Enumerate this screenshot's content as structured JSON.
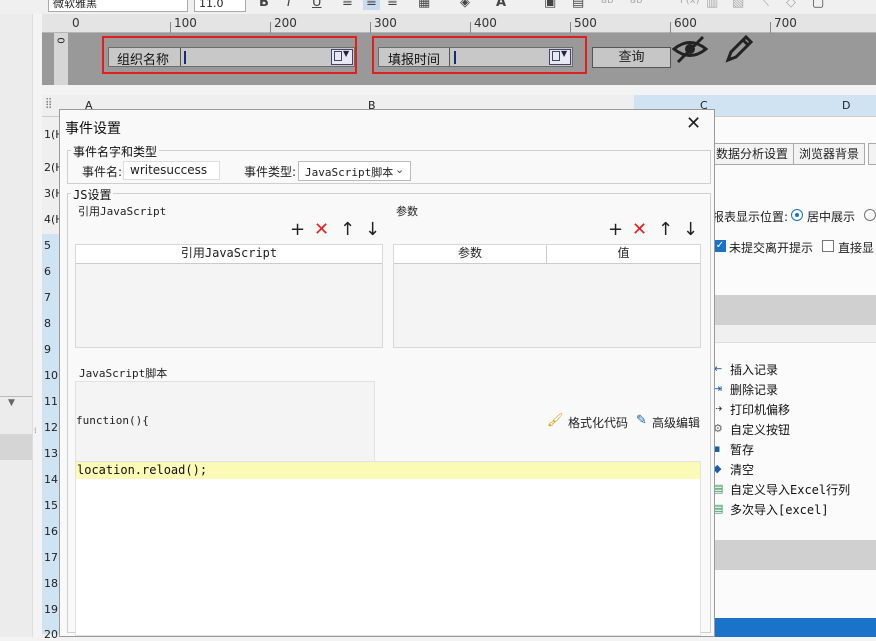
{
  "toolbar": {
    "font_name": "微软雅黑",
    "font_size": "11.0"
  },
  "ruler": {
    "marks": [
      "0",
      "100",
      "200",
      "300",
      "400",
      "500",
      "600",
      "700"
    ],
    "vmark": "0"
  },
  "form": {
    "field1_label": "组织名称",
    "field2_label": "填报时间",
    "query_label": "查询"
  },
  "sheet": {
    "col_a": "A",
    "col_b": "B",
    "col_c": "C",
    "col_d": "D",
    "rows": [
      "1(H",
      "2(H",
      "3(H",
      "4(H",
      "5",
      "6",
      "7",
      "8",
      "9",
      "10",
      "11",
      "12",
      "13",
      "14",
      "15",
      "16",
      "17",
      "18",
      "19",
      "20"
    ]
  },
  "right_panel": {
    "tab1": "数据分析设置",
    "tab2": "浏览器背景",
    "position_label": "报表显示位置:",
    "position_option": "居中展示",
    "leave_prompt": "未提交离开提示",
    "direct_label": "直接显",
    "items": [
      "插入记录",
      "删除记录",
      "打印机偏移",
      "自定义按钮",
      "暂存",
      "清空",
      "自定义导入Excel行列",
      "多次导入[excel]"
    ]
  },
  "dialog": {
    "title": "事件设置",
    "name_type_group": "事件名字和类型",
    "event_name_label": "事件名:",
    "event_name_value": "writesuccess",
    "event_type_label": "事件类型:",
    "event_type_value": "JavaScript脚本",
    "js_group": "JS设置",
    "ref_js_label": "引用JavaScript",
    "ref_js_header": "引用JavaScript",
    "params_label": "参数",
    "params_header": "参数",
    "value_header": "值",
    "script_label": "JavaScript脚本",
    "function_sig": "function(){",
    "format_label": "格式化代码",
    "advanced_label": "高级编辑",
    "code_line": "location.reload();"
  }
}
